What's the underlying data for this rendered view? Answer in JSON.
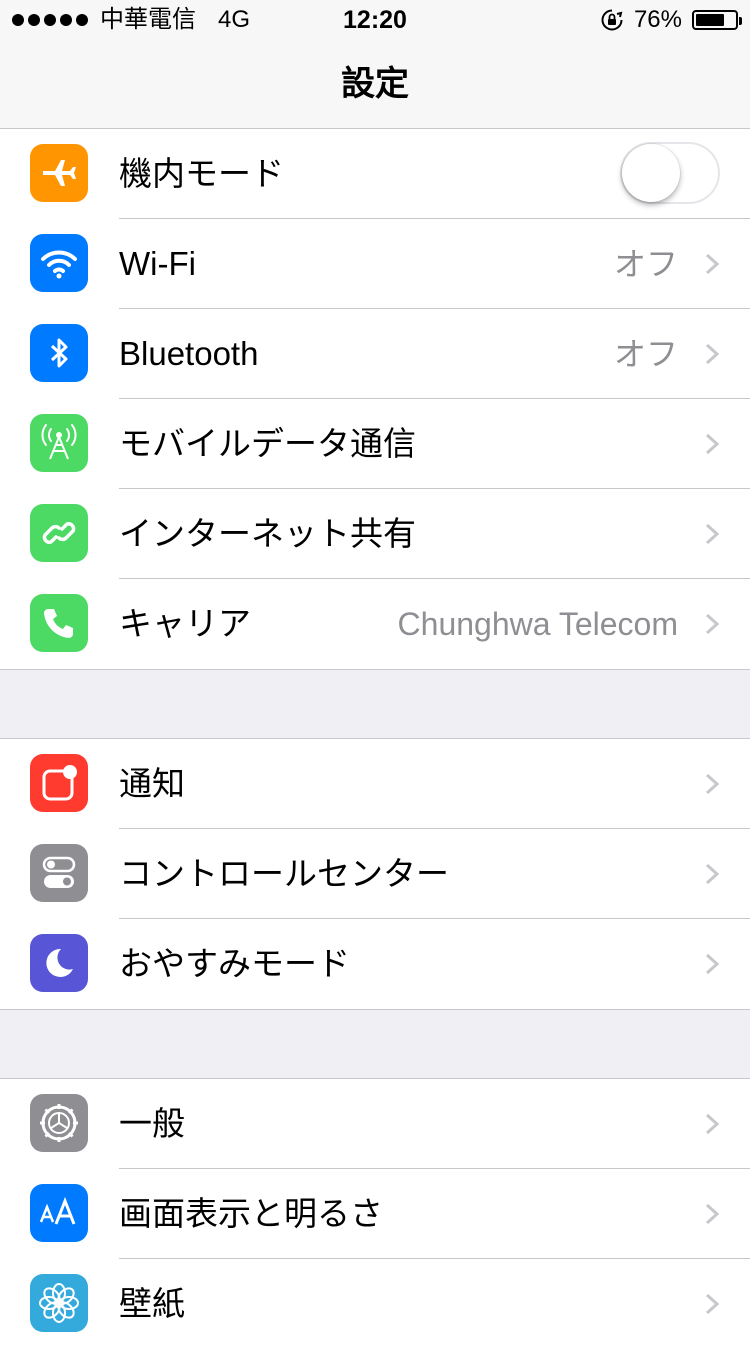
{
  "status_bar": {
    "carrier": "中華電信",
    "network": "4G",
    "time": "12:20",
    "battery_percent": "76%",
    "battery_level": 0.76
  },
  "nav": {
    "title": "設定"
  },
  "groups": [
    {
      "rows": [
        {
          "label": "機内モード",
          "icon": "airplane-icon",
          "color": "#ff9500",
          "control": "toggle",
          "toggle_on": false
        },
        {
          "label": "Wi-Fi",
          "icon": "wifi-icon",
          "color": "#007aff",
          "value": "オフ"
        },
        {
          "label": "Bluetooth",
          "icon": "bluetooth-icon",
          "color": "#007aff",
          "value": "オフ"
        },
        {
          "label": "モバイルデータ通信",
          "icon": "cellular-antenna-icon",
          "color": "#4cd964"
        },
        {
          "label": "インターネット共有",
          "icon": "chain-link-icon",
          "color": "#4cd964"
        },
        {
          "label": "キャリア",
          "icon": "phone-icon",
          "color": "#4cd964",
          "value": "Chunghwa Telecom"
        }
      ]
    },
    {
      "rows": [
        {
          "label": "通知",
          "icon": "notifications-icon",
          "color": "#ff3b30"
        },
        {
          "label": "コントロールセンター",
          "icon": "toggles-icon",
          "color": "#8e8e93"
        },
        {
          "label": "おやすみモード",
          "icon": "moon-icon",
          "color": "#5856d6"
        }
      ]
    },
    {
      "rows": [
        {
          "label": "一般",
          "icon": "gear-icon",
          "color": "#8e8e93"
        },
        {
          "label": "画面表示と明るさ",
          "icon": "text-size-icon",
          "color": "#007aff"
        },
        {
          "label": "壁紙",
          "icon": "flower-icon",
          "color": "#34aadc"
        }
      ]
    }
  ]
}
